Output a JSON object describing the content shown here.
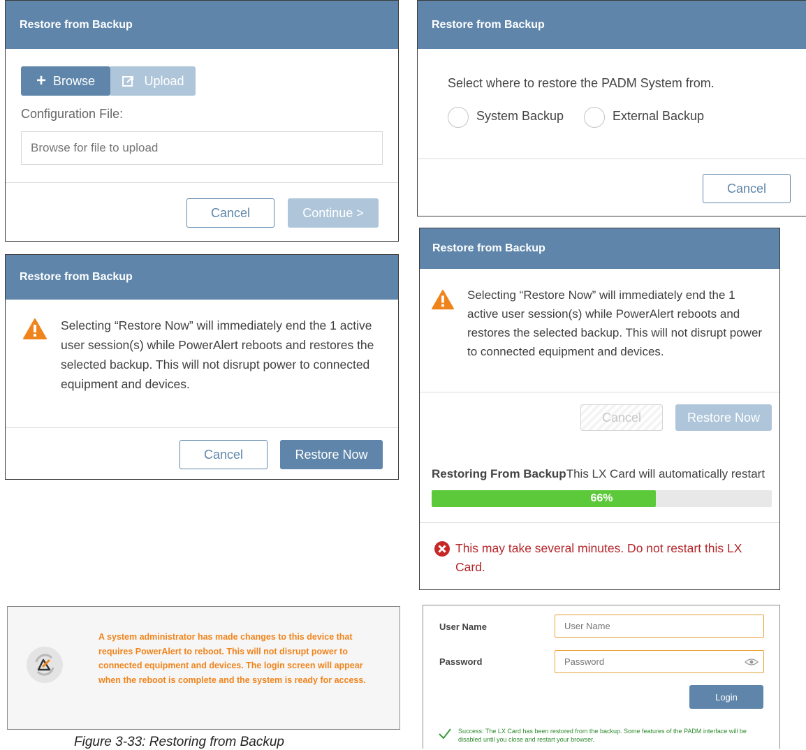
{
  "panel_upload": {
    "title": "Restore from Backup",
    "browse_label": "Browse",
    "upload_label": "Upload",
    "config_label": "Configuration File:",
    "file_placeholder": "Browse for file to upload",
    "cancel_label": "Cancel",
    "continue_label": "Continue >"
  },
  "panel_source": {
    "title": "Restore from Backup",
    "prompt": "Select where to restore the PADM System from.",
    "options": [
      "System Backup",
      "External Backup"
    ],
    "cancel_label": "Cancel"
  },
  "panel_confirm": {
    "title": "Restore from Backup",
    "warning": "Selecting “Restore Now” will immediately end the 1 active user session(s) while PowerAlert reboots and restores the selected backup. This will not disrupt power to connected equipment and devices.",
    "cancel_label": "Cancel",
    "restore_label": "Restore Now"
  },
  "panel_progress": {
    "title": "Restore from Backup",
    "warning": "Selecting “Restore Now” will immediately end the 1 active user session(s) while PowerAlert reboots and restores the selected backup. This will not disrupt power to connected equipment and devices.",
    "cancel_label": "Cancel",
    "restore_label": "Restore Now",
    "status_bold": "Restoring From Backup",
    "status_text": "This LX Card will automatically restart",
    "progress_label": "66%",
    "progress_value": 66,
    "error_text": "This may take several minutes. Do not restart this LX Card."
  },
  "panel_reboot": {
    "message": "A system administrator has made changes to this device that requires PowerAlert to reboot. This will not disrupt power to connected equipment and devices. The login screen will appear when the reboot is complete and the system is ready for access."
  },
  "panel_login": {
    "username_label": "User Name",
    "username_placeholder": "User Name",
    "password_label": "Password",
    "password_placeholder": "Password",
    "login_label": "Login",
    "success_text": "Success: The LX Card has been restored from the backup. Some features of the PADM interface will be disabled until you close and restart your browser."
  },
  "caption": "Figure 3-33: Restoring from Backup",
  "colors": {
    "header": "#5f86aa",
    "warning_orange": "#f0841c",
    "progress_green": "#5cc93a",
    "error_red": "#c62828",
    "success_green": "#3a9a3a"
  }
}
